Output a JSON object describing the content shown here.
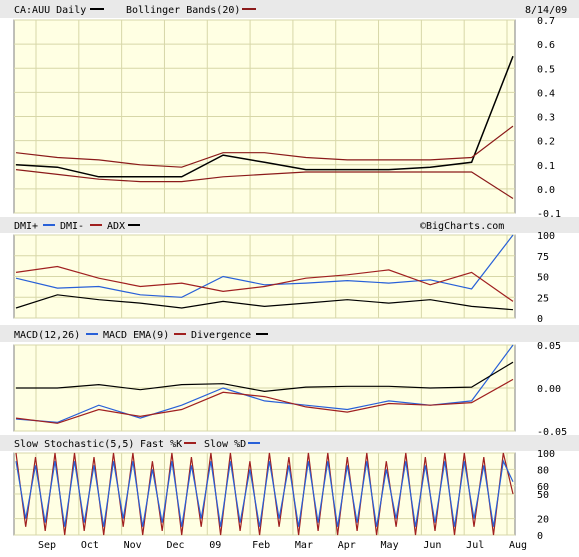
{
  "app": {
    "date_label": "8/14/09",
    "watermark": "©BigCharts.com"
  },
  "colors": {
    "panel_bg": "#ffffe3",
    "header_bg": "#e9e9e9",
    "grid": "#d7d7a8",
    "frame": "#7f7f7f",
    "price": "#000000",
    "band": "#8b1a1a",
    "blue": "#2860d8",
    "red": "#a02020",
    "black": "#000000"
  },
  "x_axis": {
    "labels": [
      "Sep",
      "Oct",
      "Nov",
      "Dec",
      "09",
      "Feb",
      "Mar",
      "Apr",
      "May",
      "Jun",
      "Jul",
      "Aug"
    ]
  },
  "chart_data": [
    {
      "type": "line",
      "title": "CA:AUU Daily",
      "legend": [
        {
          "label": "CA:AUU Daily",
          "color": "#000000"
        },
        {
          "label": "Bollinger Bands(20)",
          "color": "#8b1a1a"
        }
      ],
      "yticks": [
        "0.7",
        "0.6",
        "0.5",
        "0.4",
        "0.3",
        "0.2",
        "0.1",
        "0.0",
        "-0.1"
      ],
      "ylim": [
        -0.1,
        0.7
      ],
      "x": [
        "Sep",
        "Oct",
        "Nov",
        "Dec",
        "09",
        "Feb",
        "Mar",
        "Apr",
        "May",
        "Jun",
        "Jul",
        "Aug"
      ],
      "series": [
        {
          "name": "CA:AUU Daily",
          "values": [
            0.1,
            0.09,
            0.05,
            0.05,
            0.05,
            0.14,
            0.11,
            0.08,
            0.08,
            0.08,
            0.09,
            0.11,
            0.55
          ]
        },
        {
          "name": "Bollinger Bands(20) upper",
          "values": [
            0.15,
            0.13,
            0.12,
            0.1,
            0.09,
            0.15,
            0.15,
            0.13,
            0.12,
            0.12,
            0.12,
            0.13,
            0.26
          ]
        },
        {
          "name": "Bollinger Bands(20) lower",
          "values": [
            0.08,
            0.06,
            0.04,
            0.03,
            0.03,
            0.05,
            0.06,
            0.07,
            0.07,
            0.07,
            0.07,
            0.07,
            -0.04
          ]
        }
      ]
    },
    {
      "type": "line",
      "title": "DMI+ DMI- ADX",
      "legend": [
        {
          "label": "DMI+",
          "color": "#2860d8"
        },
        {
          "label": "DMI-",
          "color": "#a02020"
        },
        {
          "label": "ADX",
          "color": "#000000"
        }
      ],
      "yticks": [
        "100",
        "75",
        "50",
        "25",
        "0"
      ],
      "ylim": [
        0,
        100
      ],
      "series": [
        {
          "name": "DMI+",
          "values": [
            48,
            36,
            38,
            28,
            25,
            50,
            40,
            42,
            45,
            42,
            46,
            35,
            100
          ]
        },
        {
          "name": "DMI-",
          "values": [
            55,
            62,
            48,
            38,
            42,
            32,
            38,
            48,
            52,
            58,
            40,
            55,
            20
          ]
        },
        {
          "name": "ADX",
          "values": [
            12,
            28,
            22,
            18,
            12,
            20,
            14,
            18,
            22,
            18,
            22,
            14,
            10
          ]
        }
      ]
    },
    {
      "type": "line",
      "title": "MACD(12,26) MACD EMA(9) Divergence",
      "legend": [
        {
          "label": "MACD(12,26)",
          "color": "#2860d8"
        },
        {
          "label": "MACD EMA(9)",
          "color": "#a02020"
        },
        {
          "label": "Divergence",
          "color": "#000000"
        }
      ],
      "yticks": [
        "0.05",
        "0.00",
        "-0.05"
      ],
      "ylim": [
        -0.05,
        0.05
      ],
      "series": [
        {
          "name": "MACD(12,26)",
          "values": [
            -0.036,
            -0.04,
            -0.02,
            -0.035,
            -0.02,
            0.0,
            -0.015,
            -0.02,
            -0.025,
            -0.015,
            -0.02,
            -0.015,
            0.05
          ]
        },
        {
          "name": "MACD EMA(9)",
          "values": [
            -0.035,
            -0.041,
            -0.025,
            -0.033,
            -0.025,
            -0.005,
            -0.01,
            -0.022,
            -0.028,
            -0.018,
            -0.02,
            -0.017,
            0.01
          ]
        },
        {
          "name": "Divergence",
          "values": [
            0.0,
            0.0,
            0.004,
            -0.002,
            0.004,
            0.005,
            -0.004,
            0.001,
            0.002,
            0.002,
            0.0,
            0.001,
            0.03
          ]
        }
      ]
    },
    {
      "type": "line",
      "title": "Slow Stochastic(5,5) Fast %K Slow %D",
      "legend": [
        {
          "label": "Slow Stochastic(5,5)",
          "color": "#000000"
        },
        {
          "label": "Fast %K",
          "color": "#a02020"
        },
        {
          "label": "Slow %D",
          "color": "#2860d8"
        }
      ],
      "yticks": [
        "100",
        "80",
        "60",
        "50",
        "20",
        "0"
      ],
      "ylim": [
        0,
        100
      ],
      "series": [
        {
          "name": "Fast %K",
          "values": [
            100,
            10,
            95,
            5,
            100,
            0,
            100,
            5,
            95,
            0,
            100,
            10,
            100,
            0,
            90,
            5,
            100,
            0,
            95,
            10,
            100,
            0,
            100,
            5,
            90,
            0,
            100,
            10,
            95,
            0,
            100,
            5,
            100,
            0,
            95,
            5,
            100,
            0,
            90,
            10,
            100,
            0,
            95,
            5,
            100,
            0,
            100,
            10,
            95,
            0,
            100,
            50
          ]
        },
        {
          "name": "Slow %D",
          "values": [
            90,
            20,
            85,
            15,
            90,
            10,
            90,
            15,
            85,
            10,
            90,
            20,
            90,
            10,
            80,
            15,
            90,
            10,
            85,
            20,
            90,
            10,
            90,
            15,
            80,
            10,
            90,
            20,
            85,
            10,
            90,
            15,
            90,
            10,
            85,
            15,
            90,
            10,
            80,
            20,
            90,
            10,
            85,
            15,
            90,
            10,
            90,
            20,
            85,
            10,
            90,
            65
          ]
        }
      ]
    }
  ]
}
